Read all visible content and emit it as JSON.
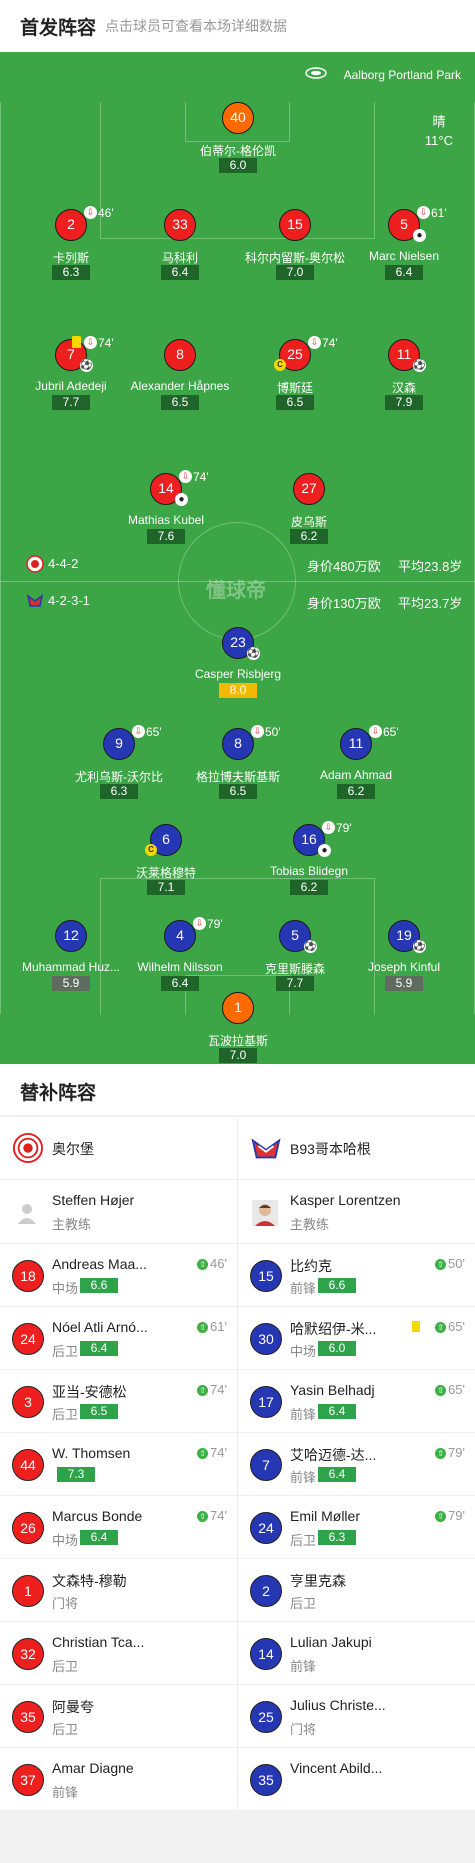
{
  "header": {
    "title": "首发阵容",
    "subtitle": "点击球员可查看本场详细数据"
  },
  "venue": "Aalborg Portland Park",
  "weather": {
    "condition": "晴",
    "temp": "11°C"
  },
  "watermark": "懂球帝",
  "home": {
    "formation": "4-4-2",
    "value": "身价480万欧",
    "age": "平均23.8岁"
  },
  "away": {
    "formation": "4-2-3-1",
    "value": "身价130万欧",
    "age": "平均23.7岁"
  },
  "colors": {
    "home": "#ee1f1f",
    "away": "#2637b3",
    "keeper": "#ff6a00",
    "pitch": "#3ca545",
    "rating": "#2ea34a"
  },
  "pitch_players": {
    "p1": {
      "num": "40",
      "name": "伯蒂尔-格伦凯",
      "rating": "6.0"
    },
    "p2": {
      "num": "2",
      "name": "卡列斯",
      "rating": "6.3",
      "time": "46'"
    },
    "p3": {
      "num": "33",
      "name": "马科利",
      "rating": "6.4"
    },
    "p4": {
      "num": "15",
      "name": "科尔内留斯-奥尔松",
      "rating": "7.0"
    },
    "p5": {
      "num": "5",
      "name": "Marc Nielsen",
      "rating": "6.4",
      "time": "61'"
    },
    "p6": {
      "num": "7",
      "name": "Jubril Adedeji",
      "rating": "7.7",
      "time": "74'"
    },
    "p7": {
      "num": "8",
      "name": "Alexander Håpnes",
      "rating": "6.5"
    },
    "p8": {
      "num": "25",
      "name": "博斯廷",
      "rating": "6.5",
      "time": "74'"
    },
    "p9": {
      "num": "11",
      "name": "汉森",
      "rating": "7.9"
    },
    "p10": {
      "num": "14",
      "name": "Mathias Kubel",
      "rating": "7.6",
      "time": "74'"
    },
    "p11": {
      "num": "27",
      "name": "皮乌斯",
      "rating": "6.2"
    },
    "a1": {
      "num": "23",
      "name": "Casper Risbjerg",
      "rating": "8.0"
    },
    "a2": {
      "num": "9",
      "name": "尤利乌斯-沃尔比",
      "rating": "6.3",
      "time": "65'"
    },
    "a3": {
      "num": "8",
      "name": "格拉博夫斯基斯",
      "rating": "6.5",
      "time": "50'"
    },
    "a4": {
      "num": "11",
      "name": "Adam Ahmad",
      "rating": "6.2",
      "time": "65'"
    },
    "a5": {
      "num": "6",
      "name": "沃莱格穆特",
      "rating": "7.1"
    },
    "a6": {
      "num": "16",
      "name": "Tobias Blidegn",
      "rating": "6.2",
      "time": "79'"
    },
    "a7": {
      "num": "12",
      "name": "Muhammad Huz...",
      "rating": "5.9"
    },
    "a8": {
      "num": "4",
      "name": "Wilhelm Nilsson",
      "rating": "6.4",
      "time": "79'"
    },
    "a9": {
      "num": "5",
      "name": "克里斯滕森",
      "rating": "7.7"
    },
    "a10": {
      "num": "19",
      "name": "Joseph Kinful",
      "rating": "5.9"
    },
    "a11": {
      "num": "1",
      "name": "瓦波拉基斯",
      "rating": "7.0"
    }
  },
  "subs": {
    "title": "替补阵容",
    "home_team": "奥尔堡",
    "away_team": "B93哥本哈根",
    "home_coach": {
      "name": "Steffen Højer",
      "role": "主教练"
    },
    "away_coach": {
      "name": "Kasper Lorentzen",
      "role": "主教练"
    },
    "home": [
      {
        "num": "18",
        "name": "Andreas Maa...",
        "pos": "中场",
        "rating": "6.6",
        "time": "46'"
      },
      {
        "num": "24",
        "name": "Nóel Atli Arnó...",
        "pos": "后卫",
        "rating": "6.4",
        "time": "61'"
      },
      {
        "num": "3",
        "name": "亚当-安德松",
        "pos": "后卫",
        "rating": "6.5",
        "time": "74'"
      },
      {
        "num": "44",
        "name": "W. Thomsen",
        "pos": "",
        "rating": "7.3",
        "time": "74'"
      },
      {
        "num": "26",
        "name": "Marcus Bonde",
        "pos": "中场",
        "rating": "6.4",
        "time": "74'"
      },
      {
        "num": "1",
        "name": "文森特-穆勒",
        "pos": "门将",
        "rating": "",
        "time": ""
      },
      {
        "num": "32",
        "name": "Christian Tca...",
        "pos": "后卫",
        "rating": "",
        "time": ""
      },
      {
        "num": "35",
        "name": "阿曼夸",
        "pos": "后卫",
        "rating": "",
        "time": ""
      },
      {
        "num": "37",
        "name": "Amar Diagne",
        "pos": "前锋",
        "rating": "",
        "time": ""
      }
    ],
    "away": [
      {
        "num": "15",
        "name": "比约克",
        "pos": "前锋",
        "rating": "6.6",
        "time": "50'"
      },
      {
        "num": "30",
        "name": "哈默绍伊-米...",
        "pos": "中场",
        "rating": "6.0",
        "time": "65'"
      },
      {
        "num": "17",
        "name": "Yasin Belhadj",
        "pos": "前锋",
        "rating": "6.4",
        "time": "65'"
      },
      {
        "num": "7",
        "name": "艾哈迈德-达...",
        "pos": "前锋",
        "rating": "6.4",
        "time": "79'"
      },
      {
        "num": "24",
        "name": "Emil Møller",
        "pos": "后卫",
        "rating": "6.3",
        "time": "79'"
      },
      {
        "num": "2",
        "name": "亨里克森",
        "pos": "后卫",
        "rating": "",
        "time": ""
      },
      {
        "num": "14",
        "name": "Lulian Jakupi",
        "pos": "前锋",
        "rating": "",
        "time": ""
      },
      {
        "num": "25",
        "name": "Julius Christe...",
        "pos": "门将",
        "rating": "",
        "time": ""
      },
      {
        "num": "35",
        "name": "Vincent Abild...",
        "pos": "",
        "rating": "",
        "time": ""
      }
    ]
  }
}
